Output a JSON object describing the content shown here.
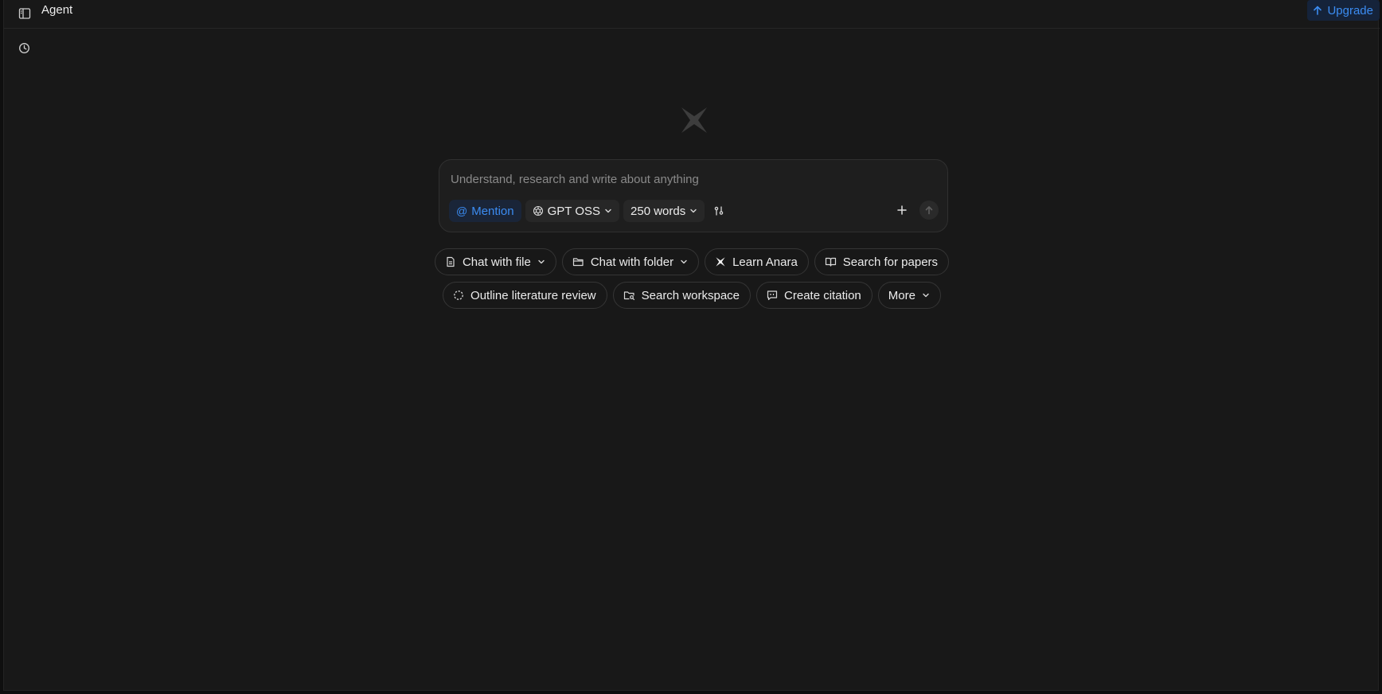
{
  "topbar": {
    "title": "Agent",
    "upgrade_label": "Upgrade"
  },
  "composer": {
    "placeholder": "Understand, research and write about anything",
    "mention_label": "Mention",
    "model_label": "GPT OSS",
    "length_label": "250 words"
  },
  "suggestions": {
    "row1": [
      {
        "label": "Chat with file",
        "icon": "file-icon",
        "dropdown": true
      },
      {
        "label": "Chat with folder",
        "icon": "folder-icon",
        "dropdown": true
      },
      {
        "label": "Learn Anara",
        "icon": "anara-logo-icon",
        "dropdown": false
      },
      {
        "label": "Search for papers",
        "icon": "book-open-icon",
        "dropdown": false
      }
    ],
    "row2": [
      {
        "label": "Outline literature review",
        "icon": "dashed-circle-icon",
        "dropdown": false
      },
      {
        "label": "Search workspace",
        "icon": "folder-search-icon",
        "dropdown": false
      },
      {
        "label": "Create citation",
        "icon": "quote-icon",
        "dropdown": false
      },
      {
        "label": "More",
        "icon": "",
        "dropdown": true
      }
    ]
  },
  "colors": {
    "background": "#181818",
    "accent": "#3b8cf2"
  }
}
